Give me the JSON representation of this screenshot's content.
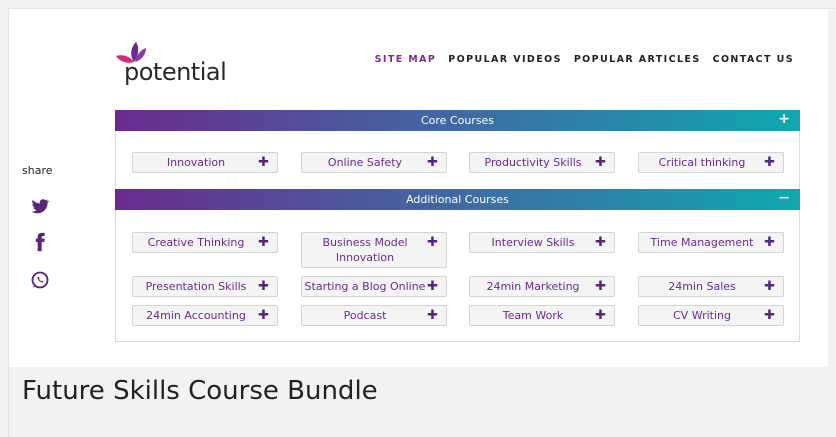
{
  "brand": {
    "logo_text": "potential",
    "accent": "#6a2a8f"
  },
  "nav": [
    {
      "label": "SITE MAP",
      "active": true
    },
    {
      "label": "POPULAR VIDEOS",
      "active": false
    },
    {
      "label": "POPULAR ARTICLES",
      "active": false
    },
    {
      "label": "CONTACT US",
      "active": false
    }
  ],
  "share": {
    "label": "share",
    "icons": [
      "twitter-icon",
      "facebook-icon",
      "whatsapp-icon"
    ]
  },
  "sections": {
    "core": {
      "title": "Core Courses",
      "toggle": "+",
      "courses": [
        "Innovation",
        "Online Safety",
        "Productivity Skills",
        "Critical thinking"
      ]
    },
    "additional": {
      "title": "Additional Courses",
      "toggle": "−",
      "courses": [
        "Creative Thinking",
        "Business Model Innovation",
        "Interview Skills",
        "Time Management",
        "Presentation Skills",
        "Starting a Blog Online",
        "24min Marketing",
        "24min Sales",
        "24min Accounting",
        "Podcast",
        "Team Work",
        "CV Writing"
      ]
    }
  },
  "plus_glyph": "✚",
  "page_title": "Future Skills Course Bundle"
}
